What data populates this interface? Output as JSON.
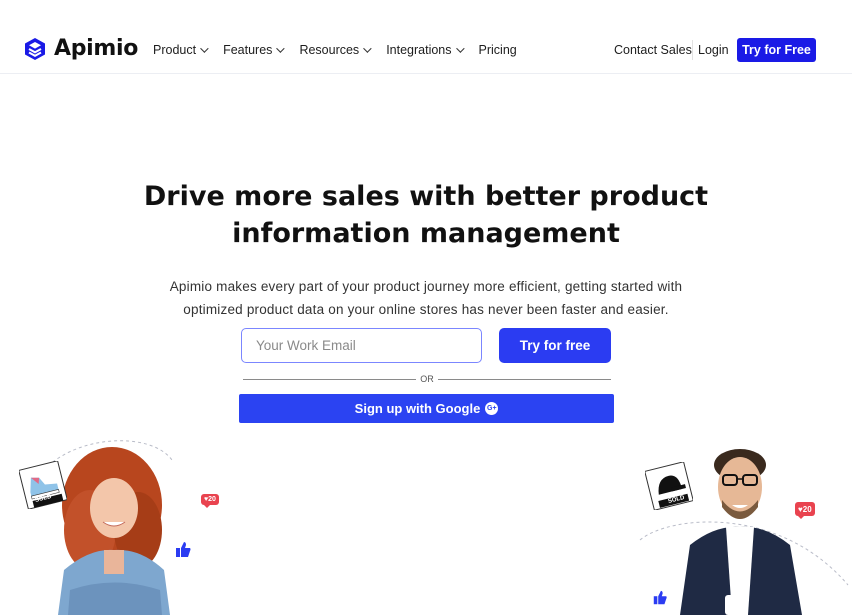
{
  "header": {
    "brand": "Apimio",
    "nav": [
      {
        "label": "Product",
        "has_dropdown": true
      },
      {
        "label": "Features",
        "has_dropdown": true
      },
      {
        "label": "Resources",
        "has_dropdown": true
      },
      {
        "label": "Integrations",
        "has_dropdown": true
      },
      {
        "label": "Pricing",
        "has_dropdown": false
      }
    ],
    "contact_sales": "Contact Sales",
    "login": "Login",
    "try_label": "Try for Free"
  },
  "hero": {
    "headline_line1": "Drive more sales with better product",
    "headline_line2": "information management",
    "subtext_line1": "Apimio makes every part of your product journey more efficient, getting started with",
    "subtext_line2": "optimized product data on your online stores has never been faster and easier.",
    "email_placeholder": "Your Work Email",
    "try_free_label": "Try for free",
    "or_label": "OR",
    "google_label": "Sign up with Google",
    "google_icon_text": "G+"
  },
  "decor": {
    "left_sold_label": "SOLD",
    "right_sold_label": "SOLD",
    "left_likes": "20",
    "right_likes": "20"
  },
  "colors": {
    "brand_blue": "#1a1ae6",
    "button_blue": "#2b3cf2",
    "like_red": "#e9434f"
  }
}
